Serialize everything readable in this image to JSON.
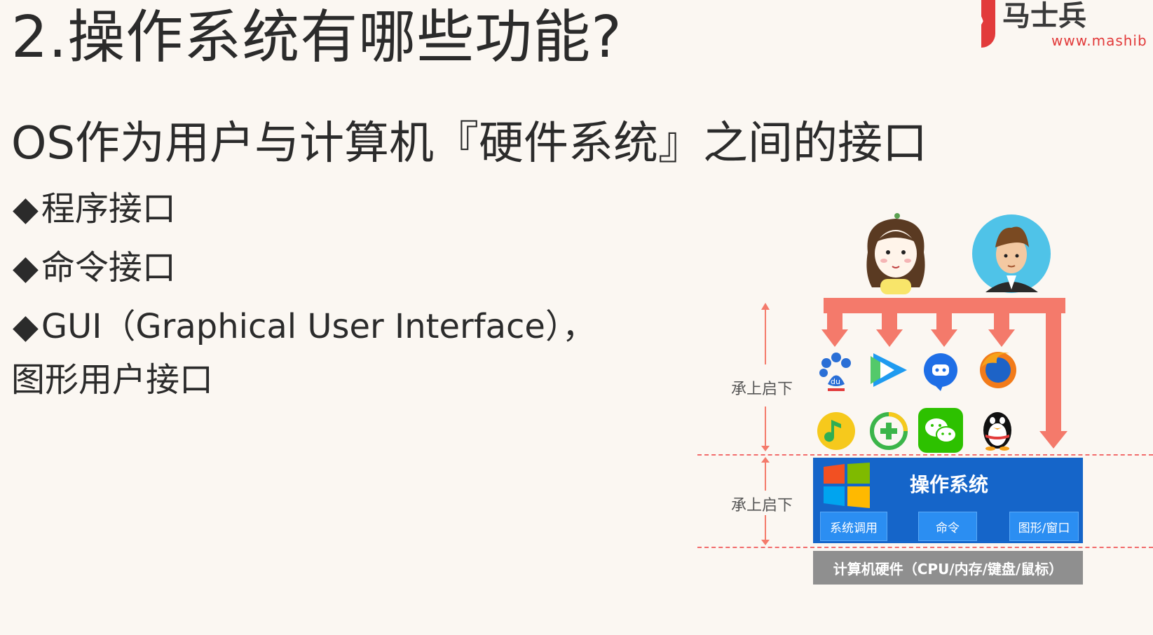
{
  "slide": {
    "title": "2.操作系统有哪些功能?",
    "subtitle": "OS作为用户与计算机『硬件系统』之间的接口",
    "bullets": [
      {
        "mark": "◆",
        "text": "程序接口"
      },
      {
        "mark": "◆",
        "text": "命令接口"
      },
      {
        "mark": "◆",
        "text": "GUI（Graphical User Interface），"
      }
    ],
    "bullet3_continuation": "图形用户接口"
  },
  "logo": {
    "url_text": "www.mashib"
  },
  "diagram": {
    "side_label_top": "承上启下",
    "side_label_bottom": "承上启下",
    "os_title": "操作系统",
    "os_buttons": [
      "系统调用",
      "命令",
      "图形/窗口"
    ],
    "hardware": "计算机硬件（CPU/内存/键盘/鼠标）",
    "colors": {
      "arrow": "#f47a6b",
      "os_box": "#1565c9",
      "os_button": "#2b8ef2",
      "hardware": "#8f8f8f",
      "dash": "#f26b6b",
      "logo": "#e23b3b"
    },
    "app_icons": [
      "baidu-icon",
      "video-icon",
      "chat-icon",
      "firefox-icon",
      "music-icon",
      "plus-icon",
      "wechat-icon",
      "qq-icon"
    ]
  }
}
